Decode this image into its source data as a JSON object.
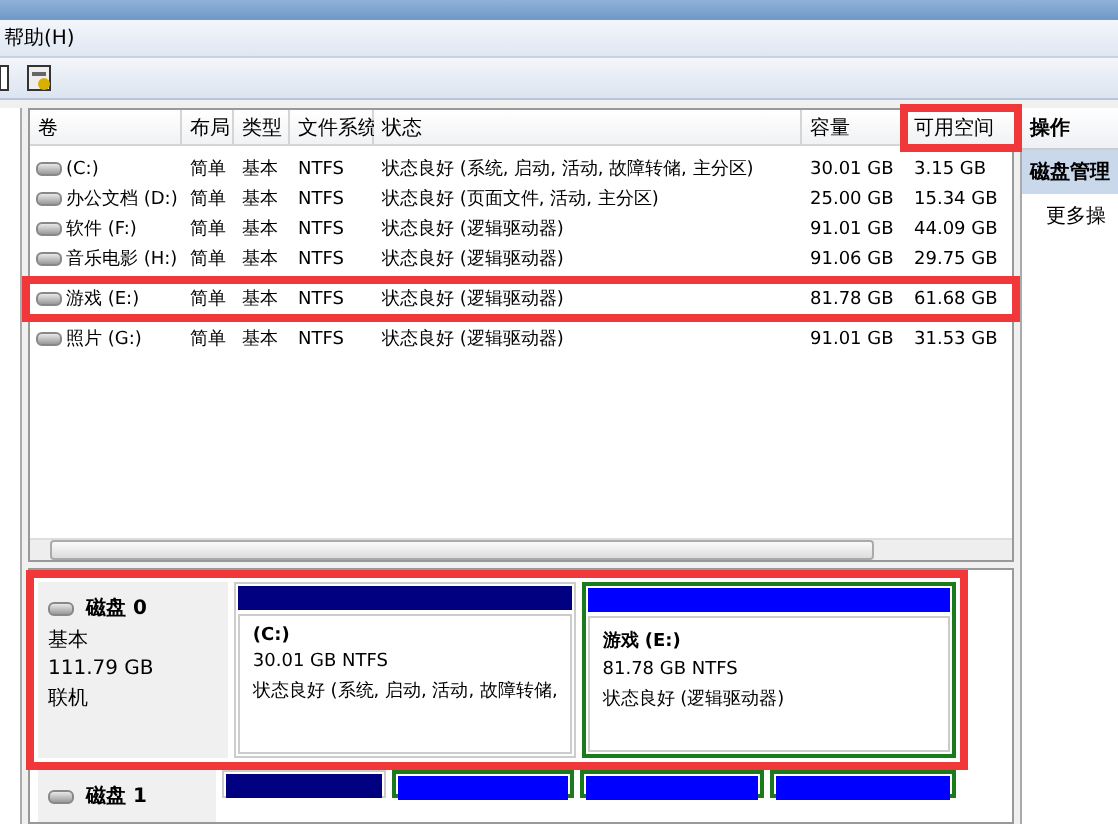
{
  "menu": [
    "帮助(H)"
  ],
  "table": {
    "columns": [
      {
        "label": "卷",
        "highlighted": false
      },
      {
        "label": "布局",
        "highlighted": false
      },
      {
        "label": "类型",
        "highlighted": false
      },
      {
        "label": "文件系统",
        "highlighted": false
      },
      {
        "label": "状态",
        "highlighted": false
      },
      {
        "label": "容量",
        "highlighted": false
      },
      {
        "label": "可用空间",
        "highlighted": true
      }
    ],
    "rows": [
      {
        "cells": [
          "(C:)",
          "简单",
          "基本",
          "NTFS",
          "状态良好 (系统, 启动, 活动, 故障转储, 主分区)",
          "30.01 GB",
          "3.15 GB"
        ],
        "highlighted": false
      },
      {
        "cells": [
          "办公文档 (D:)",
          "简单",
          "基本",
          "NTFS",
          "状态良好 (页面文件, 活动, 主分区)",
          "25.00 GB",
          "15.34 GB"
        ],
        "highlighted": false
      },
      {
        "cells": [
          "软件 (F:)",
          "简单",
          "基本",
          "NTFS",
          "状态良好 (逻辑驱动器)",
          "91.01 GB",
          "44.09 GB"
        ],
        "highlighted": false
      },
      {
        "cells": [
          "音乐电影 (H:)",
          "简单",
          "基本",
          "NTFS",
          "状态良好 (逻辑驱动器)",
          "91.06 GB",
          "29.75 GB"
        ],
        "highlighted": false
      },
      {
        "cells": [
          "游戏 (E:)",
          "简单",
          "基本",
          "NTFS",
          "状态良好 (逻辑驱动器)",
          "81.78 GB",
          "61.68 GB"
        ],
        "highlighted": true
      },
      {
        "cells": [
          "照片 (G:)",
          "简单",
          "基本",
          "NTFS",
          "状态良好 (逻辑驱动器)",
          "91.01 GB",
          "31.53 GB"
        ],
        "highlighted": false
      }
    ]
  },
  "actions": {
    "title": "操作",
    "items": [
      {
        "label": "磁盘管理",
        "selected": true
      },
      {
        "label": "更多操",
        "selected": false
      }
    ]
  },
  "disks": [
    {
      "name": "磁盘 0",
      "type": "基本",
      "size": "111.79 GB",
      "status": "联机",
      "highlighted": true,
      "partitions": [
        {
          "kind": "primary",
          "label": "(C:)",
          "size": "30.01 GB NTFS",
          "status": "状态良好 (系统, 启动, 活动, 故障转储,"
        },
        {
          "kind": "logical",
          "label": "游戏 (E:)",
          "size": "81.78 GB NTFS",
          "status": "状态良好 (逻辑驱动器)"
        }
      ]
    },
    {
      "name": "磁盘 1",
      "highlighted": false,
      "partitions": [
        {
          "kind": "primary"
        },
        {
          "kind": "logical"
        },
        {
          "kind": "logical"
        },
        {
          "kind": "logical"
        }
      ]
    }
  ]
}
